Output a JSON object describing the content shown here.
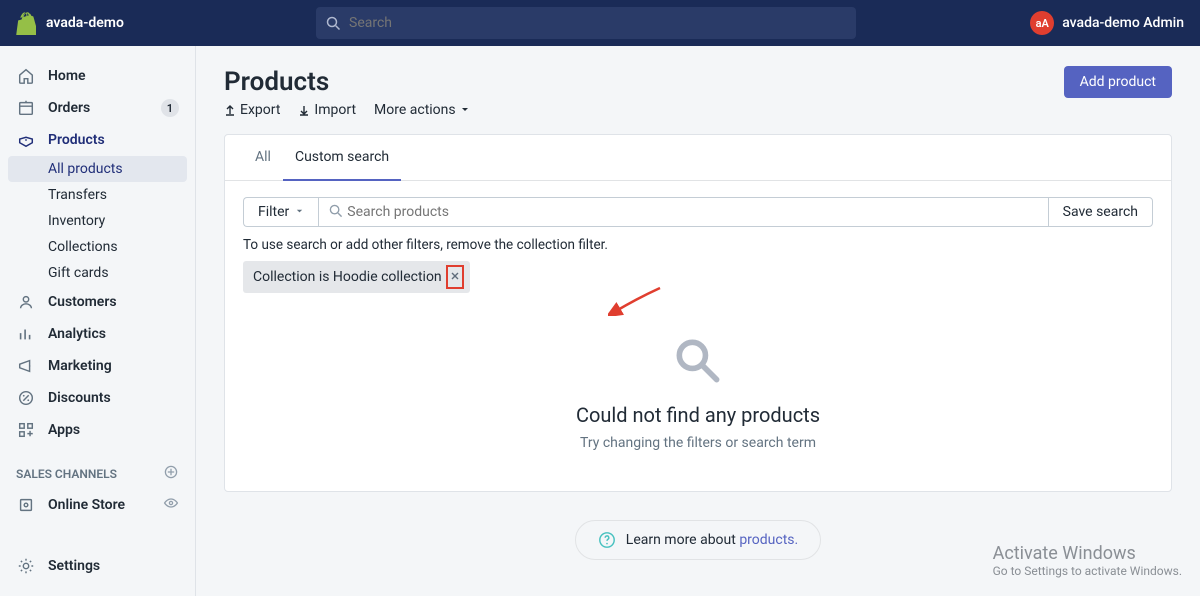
{
  "topbar": {
    "store_name": "avada-demo",
    "search_placeholder": "Search",
    "avatar_initials": "aA",
    "admin_name": "avada-demo Admin"
  },
  "sidebar": {
    "items": [
      {
        "icon": "home",
        "label": "Home"
      },
      {
        "icon": "orders",
        "label": "Orders",
        "badge": "1"
      },
      {
        "icon": "products",
        "label": "Products",
        "selected": true,
        "subitems": [
          {
            "label": "All products",
            "active": true
          },
          {
            "label": "Transfers"
          },
          {
            "label": "Inventory"
          },
          {
            "label": "Collections"
          },
          {
            "label": "Gift cards"
          }
        ]
      },
      {
        "icon": "customers",
        "label": "Customers"
      },
      {
        "icon": "analytics",
        "label": "Analytics"
      },
      {
        "icon": "marketing",
        "label": "Marketing"
      },
      {
        "icon": "discounts",
        "label": "Discounts"
      },
      {
        "icon": "apps",
        "label": "Apps"
      }
    ],
    "section_header": "SALES CHANNELS",
    "channels": [
      {
        "icon": "store",
        "label": "Online Store"
      }
    ],
    "settings_label": "Settings"
  },
  "page": {
    "title": "Products",
    "add_button": "Add product",
    "actions": {
      "export": "Export",
      "import": "Import",
      "more": "More actions"
    },
    "tabs": [
      {
        "label": "All"
      },
      {
        "label": "Custom search",
        "active": true
      }
    ],
    "filter_button": "Filter",
    "search_placeholder": "Search products",
    "save_search": "Save search",
    "helper": "To use search or add other filters, remove the collection filter.",
    "chip_label": "Collection is Hoodie collection",
    "empty_title": "Could not find any products",
    "empty_sub": "Try changing the filters or search term",
    "learn_prefix": "Learn more about ",
    "learn_link": "products."
  },
  "watermark": {
    "line1": "Activate Windows",
    "line2": "Go to Settings to activate Windows."
  }
}
